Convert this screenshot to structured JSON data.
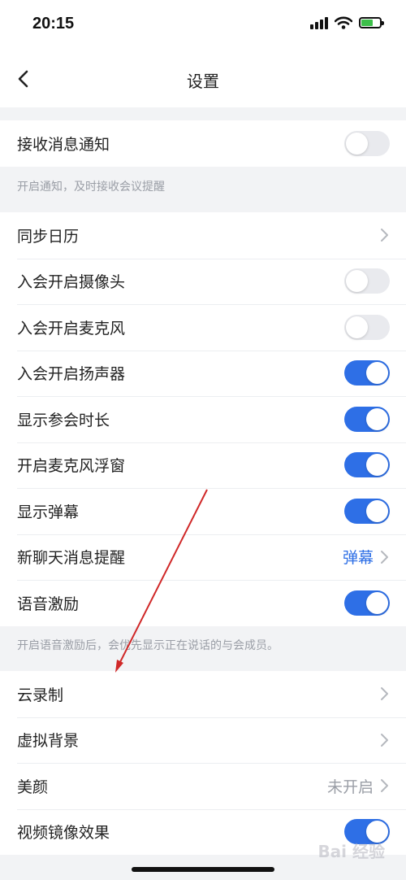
{
  "status_bar": {
    "time": "20:15"
  },
  "nav": {
    "title": "设置"
  },
  "group1": {
    "row": {
      "label": "接收消息通知",
      "toggle_on": false
    },
    "hint": "开启通知，及时接收会议提醒"
  },
  "group2": {
    "rows": [
      {
        "label": "同步日历",
        "type": "chevron"
      },
      {
        "label": "入会开启摄像头",
        "type": "toggle",
        "toggle_on": false
      },
      {
        "label": "入会开启麦克风",
        "type": "toggle",
        "toggle_on": false
      },
      {
        "label": "入会开启扬声器",
        "type": "toggle",
        "toggle_on": true
      },
      {
        "label": "显示参会时长",
        "type": "toggle",
        "toggle_on": true
      },
      {
        "label": "开启麦克风浮窗",
        "type": "toggle",
        "toggle_on": true
      },
      {
        "label": "显示弹幕",
        "type": "toggle",
        "toggle_on": true
      },
      {
        "label": "新聊天消息提醒",
        "type": "value-chevron",
        "value": "弹幕"
      },
      {
        "label": "语音激励",
        "type": "toggle",
        "toggle_on": true
      }
    ],
    "hint": "开启语音激励后，会优先显示正在说话的与会成员。"
  },
  "group3": {
    "rows": [
      {
        "label": "云录制",
        "type": "chevron"
      },
      {
        "label": "虚拟背景",
        "type": "chevron"
      },
      {
        "label": "美颜",
        "type": "value-chevron",
        "value": "未开启"
      },
      {
        "label": "视频镜像效果",
        "type": "toggle",
        "toggle_on": true
      }
    ]
  },
  "watermark": "Bai 经验",
  "colors": {
    "accent": "#2e6fe6",
    "toggle_off": "#e9eaee",
    "hint_text": "#9a9ea6",
    "link_value": "#2e6fe6",
    "muted_value": "#9a9ea6",
    "background": "#f2f3f5",
    "annotation_arrow": "#d02828"
  },
  "icons": [
    "signal-icon",
    "wifi-icon",
    "battery-icon",
    "back-icon",
    "chevron-right-icon"
  ]
}
